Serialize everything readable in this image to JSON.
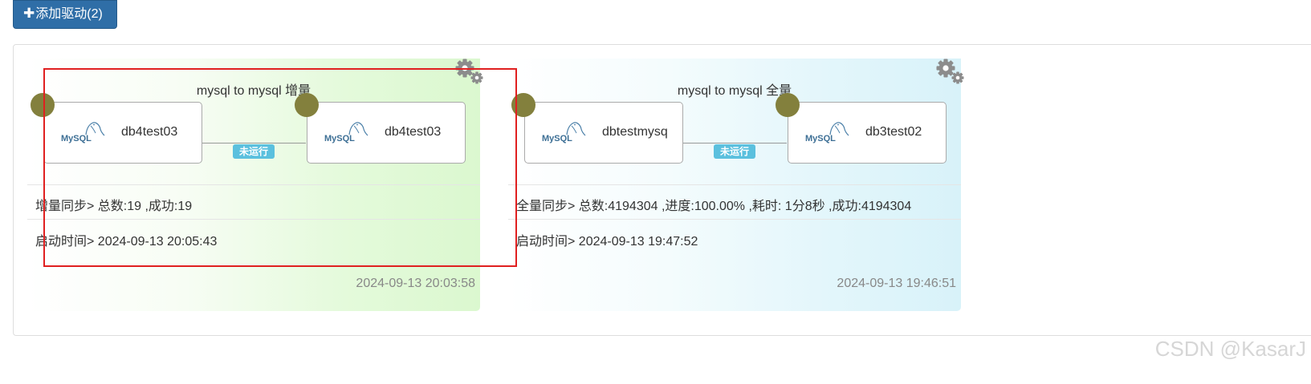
{
  "toolbar": {
    "add_driver_label": "添加驱动(2)",
    "plus_glyph": "✚"
  },
  "colors": {
    "button_bg": "#2f6ea7",
    "endpoint": "#83803d",
    "badge": "#5bc0de",
    "highlight_border": "#e02020"
  },
  "drivers": [
    {
      "title": "mysql to mysql 增量",
      "source_name": "db4test03",
      "target_name": "db4test03",
      "source_logo": "MySQL",
      "target_logo": "MySQL",
      "status": "未运行",
      "sync_info": "增量同步> 总数:19 ,成功:19",
      "start_time": "启动时间> 2024-09-13 20:05:43",
      "updated_at": "2024-09-13 20:03:58"
    },
    {
      "title": "mysql to mysql 全量",
      "source_name": "dbtestmysq",
      "target_name": "db3test02",
      "source_logo": "MySQL",
      "target_logo": "MySQL",
      "status": "未运行",
      "sync_info": "全量同步> 总数:4194304 ,进度:100.00% ,耗时: 1分8秒 ,成功:4194304",
      "start_time": "启动时间> 2024-09-13 19:47:52",
      "updated_at": "2024-09-13 19:46:51"
    }
  ],
  "watermark": "CSDN @KasarJ"
}
